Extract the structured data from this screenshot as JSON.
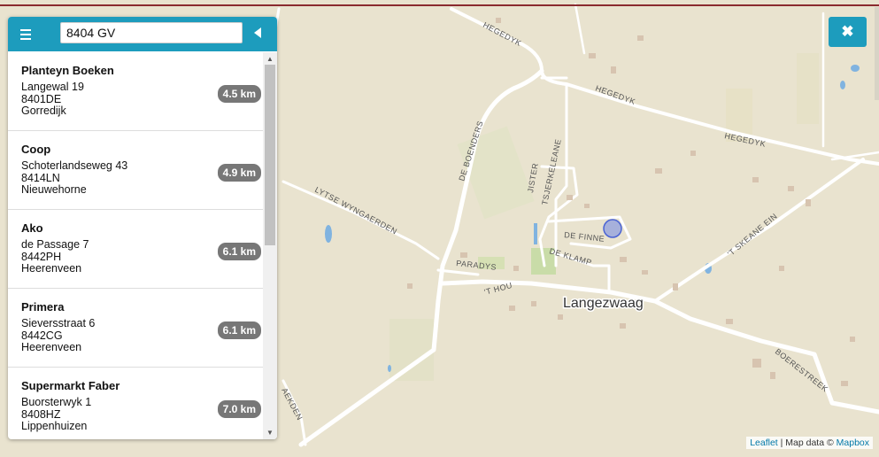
{
  "search": {
    "value": "8404 GV"
  },
  "icons": {
    "menu": "hamburger-icon",
    "collapse": "caret-left-icon",
    "close": "close-icon"
  },
  "results": [
    {
      "name": "Planteyn Boeken",
      "street": "Langewal 19",
      "postcode": "8401DE",
      "city": "Gorredijk",
      "distance": "4.5 km"
    },
    {
      "name": "Coop",
      "street": "Schoterlandseweg 43",
      "postcode": "8414LN",
      "city": "Nieuwehorne",
      "distance": "4.9 km"
    },
    {
      "name": "Ako",
      "street": "de Passage 7",
      "postcode": "8442PH",
      "city": "Heerenveen",
      "distance": "6.1 km"
    },
    {
      "name": "Primera",
      "street": "Sieversstraat 6",
      "postcode": "8442CG",
      "city": "Heerenveen",
      "distance": "6.1 km"
    },
    {
      "name": "Supermarkt Faber",
      "street": "Buorsterwyk 1",
      "postcode": "8408HZ",
      "city": "Lippenhuizen",
      "distance": "7.0 km"
    }
  ],
  "close_label": "✖",
  "attribution": {
    "leaflet": "Leaflet",
    "separator": " | Map data © ",
    "mapbox": "Mapbox"
  },
  "map": {
    "town": "Langezwaag",
    "roads": {
      "hegedyk": "HEGEDYK",
      "de_boenders": "DE BOENDERS",
      "lytse_wyngaerden": "LYTSE WYNGAERDEN",
      "paradys": "PARADYS",
      "t_hou": "'T HOU",
      "jister": "JISTER",
      "tsjerkeleane": "TSJERKELEANE",
      "de_finne": "DE FINNE",
      "de_klamp": "DE KLAMP",
      "t_skeane_ein": "'T SKEANE EIN",
      "boerestreek": "BOERESTREEK",
      "aekden": "AEKDEN"
    },
    "colors": {
      "land": "#e9e3cf",
      "road": "#ffffff",
      "water": "#80b3e0",
      "park": "#c9dca8",
      "marker": "#6f86e6"
    }
  }
}
